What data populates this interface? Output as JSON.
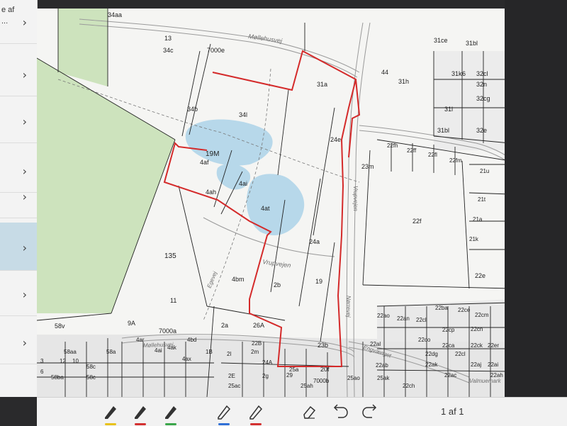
{
  "sidebar": {
    "header_label": "e af",
    "items": [
      {
        "label": "..."
      },
      {
        "label": ""
      },
      {
        "label": ""
      },
      {
        "label": ""
      },
      {
        "label": ""
      },
      {
        "label": ""
      },
      {
        "label": ""
      },
      {
        "label": ""
      }
    ],
    "selected_index": 5
  },
  "map": {
    "parcels": [
      "34aa",
      "13",
      "34c",
      "7000e",
      "34b",
      "34l",
      "31a",
      "44",
      "31h",
      "31k",
      "6",
      "32cl",
      "31bl",
      "31ce",
      "32n",
      "32cg",
      "31l",
      "32e",
      "31bl",
      "19M",
      "4af",
      "4ai",
      "4ah",
      "4at",
      "24e",
      "24a",
      "23m",
      "22fh",
      "22ff",
      "22fl",
      "22fm",
      "21u",
      "21t",
      "21a",
      "21k",
      "22f",
      "22e",
      "135",
      "4bm",
      "2b",
      "19",
      "11",
      "58v",
      "9A",
      "7000a",
      "2a",
      "26A",
      "23b",
      "20f",
      "58a",
      "58c",
      "58ba",
      "58c",
      "12",
      "10",
      "58aa",
      "3",
      "6",
      "4ar",
      "4ax",
      "4ai",
      "4ak",
      "4bd",
      "1B",
      "2l",
      "2m",
      "24A",
      "22B",
      "2g",
      "29",
      "2E",
      "25ac",
      "25a",
      "7000b",
      "25ah",
      "25ao",
      "25ak",
      "22ch",
      "22ba",
      "22ao",
      "22an",
      "22cl",
      "22ce",
      "22co",
      "22cm",
      "22cp",
      "22ca",
      "22cl",
      "22dg",
      "22ab",
      "22al",
      "22ak",
      "22ac",
      "22cn",
      "22ck",
      "22aj",
      "22er",
      "22ai",
      "22ah"
    ],
    "roads": [
      "Møllehusvej",
      "Vrupvejen",
      "Vrupvejen",
      "Egevej",
      "Møllehusvej",
      "Nørrevej",
      "Engvænget"
    ],
    "cut_labels": [
      "Valmuemark"
    ]
  },
  "toolbar": {
    "tools": [
      {
        "name": "pen-yellow",
        "color": "#e8c21b"
      },
      {
        "name": "pen-red",
        "color": "#d33030"
      },
      {
        "name": "pen-green",
        "color": "#3aa64a"
      },
      {
        "name": "pencil-blue",
        "color": "#2f6fd6"
      },
      {
        "name": "pencil-red",
        "color": "#d33030"
      },
      {
        "name": "eraser",
        "color": ""
      },
      {
        "name": "undo",
        "color": ""
      },
      {
        "name": "redo",
        "color": ""
      }
    ],
    "page_indicator": "1 af 1"
  }
}
